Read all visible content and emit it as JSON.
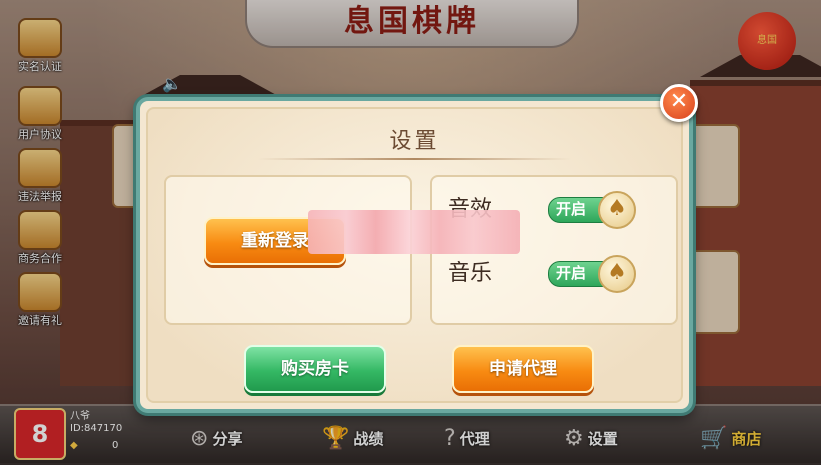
{
  "header": {
    "title": "息国棋牌",
    "lantern_text": "息国"
  },
  "side_menu": [
    {
      "label": "实名认证",
      "icon": "id-card-icon"
    },
    {
      "label": "用户协议",
      "icon": "document-icon"
    },
    {
      "label": "违法举报",
      "icon": "shield-icon"
    },
    {
      "label": "商务合作",
      "icon": "handshake-icon"
    },
    {
      "label": "邀请有礼",
      "icon": "gift-icon"
    }
  ],
  "settings_dialog": {
    "title": "设置",
    "relogin_label": "重新登录",
    "sound_effect_label": "音效",
    "music_label": "音乐",
    "sound_effect_toggle": "开启",
    "music_toggle": "开启",
    "buy_room_card_label": "购买房卡",
    "apply_agent_label": "申请代理",
    "close_symbol": "✕"
  },
  "profile": {
    "name": "八爷",
    "id_text": "ID:847170",
    "coins": "0",
    "avatar_text": "8"
  },
  "bottom_nav": [
    {
      "label": "分享",
      "icon": "share-icon"
    },
    {
      "label": "战绩",
      "icon": "trophy-icon"
    },
    {
      "label": "代理",
      "icon": "question-icon"
    },
    {
      "label": "设置",
      "icon": "gear-icon"
    },
    {
      "label": "商店",
      "icon": "cart-icon"
    }
  ],
  "icons": {
    "speaker": "🔈",
    "knob": "♠",
    "share": "⊛",
    "trophy": "🏆",
    "question": "?",
    "gear": "⚙",
    "cart": "🛒",
    "gem": "◆"
  },
  "colors": {
    "accent_orange": "#f88b12",
    "accent_green": "#34b864",
    "dialog_border": "#6aa8a0",
    "title_red": "#8b1d14"
  }
}
